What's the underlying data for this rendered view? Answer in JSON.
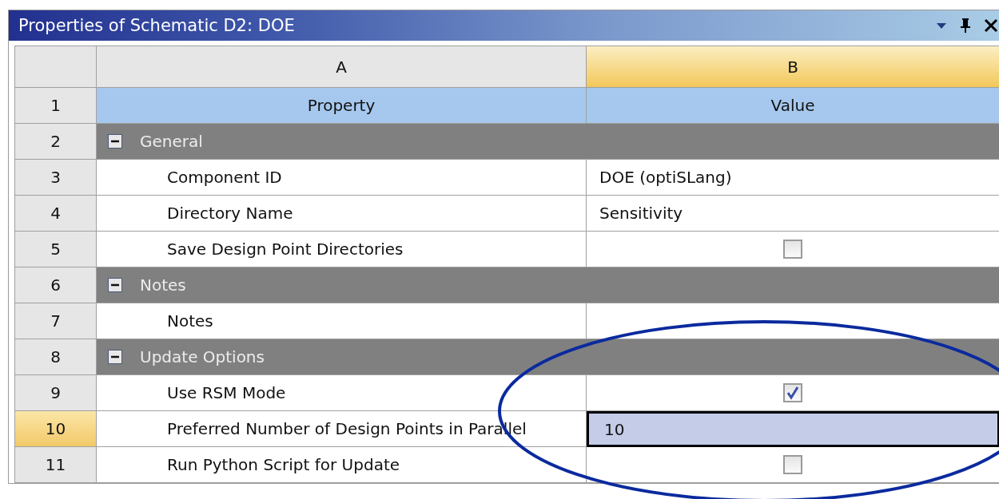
{
  "window": {
    "title": "Properties of Schematic D2: DOE"
  },
  "columns": [
    {
      "label": "A",
      "selected": false
    },
    {
      "label": "B",
      "selected": true
    }
  ],
  "rows": [
    {
      "number": "1",
      "kind": "header",
      "property": "Property",
      "value": "Value",
      "selected": false
    },
    {
      "number": "2",
      "kind": "group",
      "label": "General",
      "expanded": true,
      "selected": false
    },
    {
      "number": "3",
      "kind": "text",
      "property": "Component ID",
      "value": "DOE (optiSLang)",
      "selected": false
    },
    {
      "number": "4",
      "kind": "text",
      "property": "Directory Name",
      "value": "Sensitivity",
      "selected": false
    },
    {
      "number": "5",
      "kind": "checkbox",
      "property": "Save Design Point Directories",
      "checked": false,
      "selected": false
    },
    {
      "number": "6",
      "kind": "group",
      "label": "Notes",
      "expanded": true,
      "selected": false
    },
    {
      "number": "7",
      "kind": "text",
      "property": "Notes",
      "selected": false
    },
    {
      "number": "8",
      "kind": "group",
      "label": "Update Options",
      "expanded": true,
      "selected": false
    },
    {
      "number": "9",
      "kind": "checkbox",
      "property": "Use RSM Mode",
      "checked": true,
      "selected": false
    },
    {
      "number": "10",
      "kind": "text",
      "property": "Preferred Number of Design Points in Parallel",
      "value": "10",
      "selected": true
    },
    {
      "number": "11",
      "kind": "checkbox",
      "property": "Run Python Script for Update",
      "checked": false,
      "selected": false
    }
  ]
}
